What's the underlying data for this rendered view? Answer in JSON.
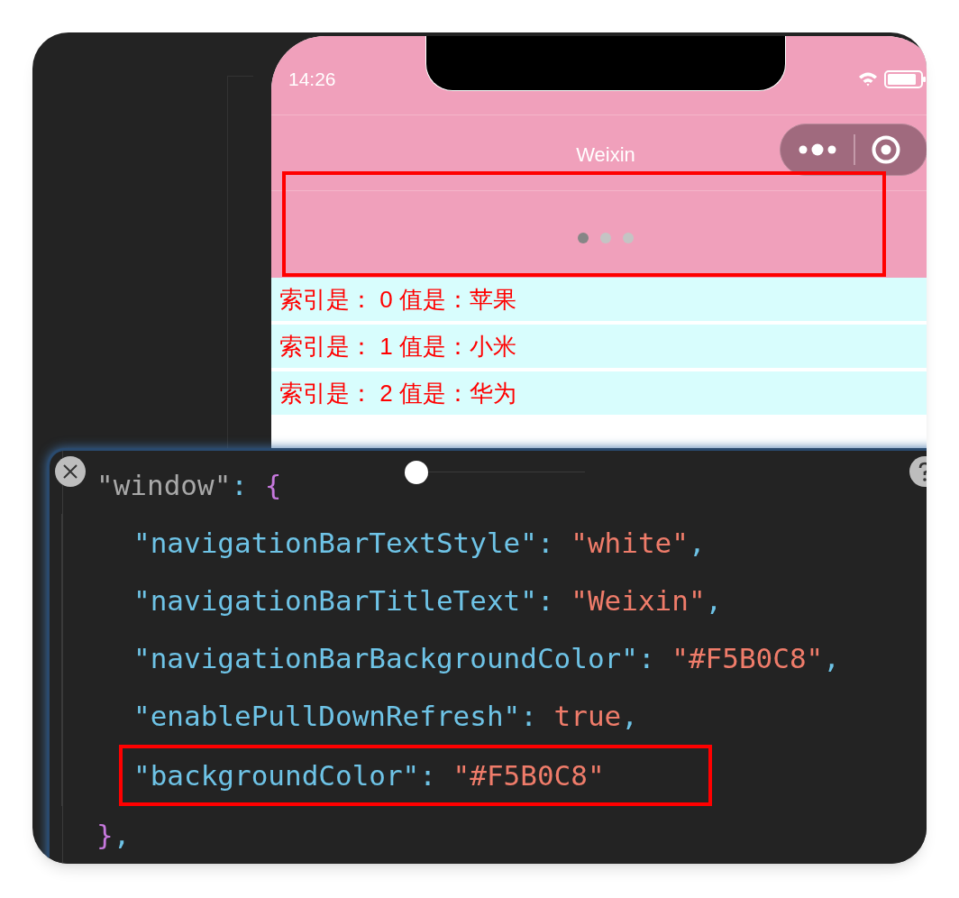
{
  "status_bar": {
    "time": "14:26"
  },
  "nav_bar": {
    "title": "Weixin"
  },
  "swiper": {
    "outlined": true,
    "dots": [
      {
        "selected": true
      },
      {
        "selected": false
      },
      {
        "selected": false
      }
    ]
  },
  "list": [
    {
      "text": "索引是： 0 值是：苹果"
    },
    {
      "text": "索引是： 1 值是：小米"
    },
    {
      "text": "索引是： 2 值是：华为"
    }
  ],
  "code_popup": {
    "lines": [
      {
        "outlined": false,
        "tokens": [
          {
            "kind": "muted",
            "text": "\"window\""
          },
          {
            "kind": "punct",
            "text": ": "
          },
          {
            "kind": "brace",
            "text": "{"
          }
        ],
        "children": [
          {
            "outlined": false,
            "tokens": [
              {
                "kind": "key",
                "text": "\"navigationBarTextStyle\""
              },
              {
                "kind": "punct",
                "text": ": "
              },
              {
                "kind": "string",
                "text": "\"white\""
              },
              {
                "kind": "punct",
                "text": ","
              }
            ]
          },
          {
            "outlined": false,
            "tokens": [
              {
                "kind": "key",
                "text": "\"navigationBarTitleText\""
              },
              {
                "kind": "punct",
                "text": ": "
              },
              {
                "kind": "string",
                "text": "\"Weixin\""
              },
              {
                "kind": "punct",
                "text": ","
              }
            ]
          },
          {
            "outlined": false,
            "tokens": [
              {
                "kind": "key",
                "text": "\"navigationBarBackgroundColor\""
              },
              {
                "kind": "punct",
                "text": ": "
              },
              {
                "kind": "string",
                "text": "\"#F5B0C8\""
              },
              {
                "kind": "punct",
                "text": ","
              }
            ]
          },
          {
            "outlined": false,
            "tokens": [
              {
                "kind": "key",
                "text": "\"enablePullDownRefresh\""
              },
              {
                "kind": "punct",
                "text": ": "
              },
              {
                "kind": "literal",
                "text": "true"
              },
              {
                "kind": "punct",
                "text": ","
              }
            ]
          },
          {
            "outlined": true,
            "tokens": [
              {
                "kind": "key",
                "text": "\"backgroundColor\""
              },
              {
                "kind": "punct",
                "text": ": "
              },
              {
                "kind": "string",
                "text": "\"#F5B0C8\""
              }
            ]
          }
        ]
      },
      {
        "outlined": false,
        "tokens": [
          {
            "kind": "brace",
            "text": "}"
          },
          {
            "kind": "punct",
            "text": ","
          }
        ]
      }
    ]
  }
}
